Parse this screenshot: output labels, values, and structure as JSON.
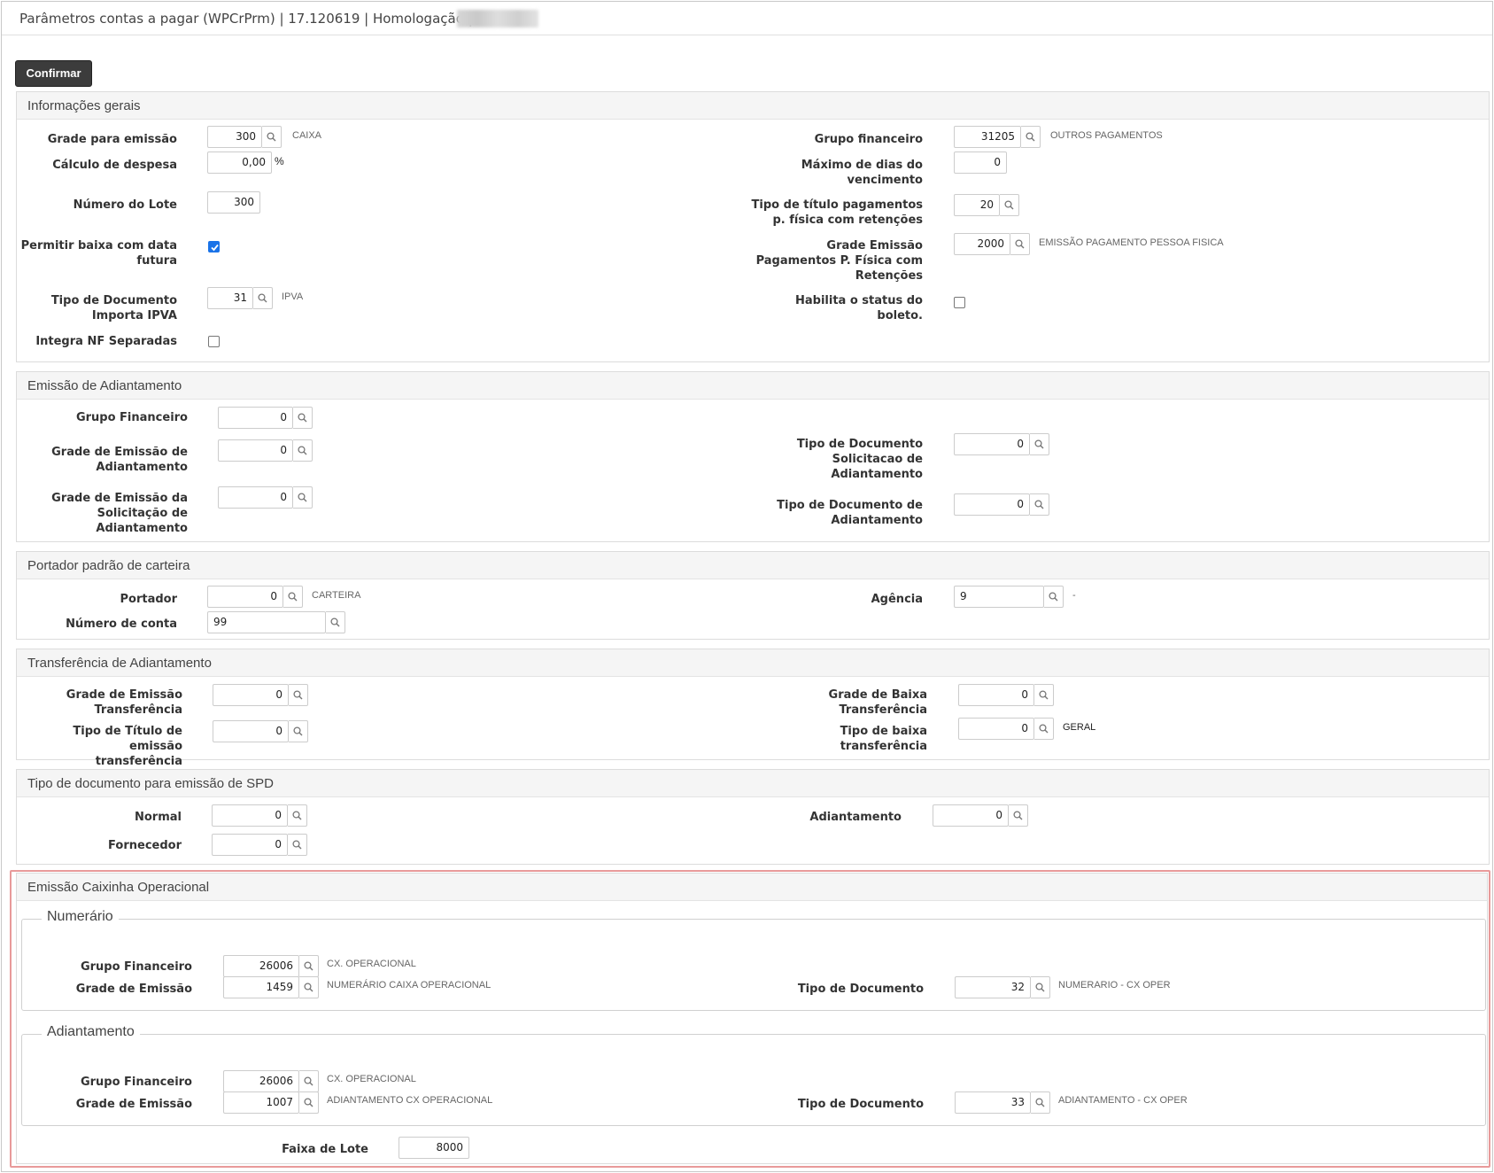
{
  "window": {
    "title": "Parâmetros contas a pagar (WPCrPrm) | 17.120619 | Homologação | S"
  },
  "toolbar": {
    "confirm_label": "Confirmar"
  },
  "sections": {
    "info_gerais": {
      "title": "Informações gerais",
      "grade_emissao": {
        "label": "Grade para emissão",
        "value": "300",
        "desc": "CAIXA"
      },
      "calculo_despesa": {
        "label": "Cálculo de despesa",
        "value": "0,00",
        "unit": "%"
      },
      "numero_lote": {
        "label": "Número do Lote",
        "value": "300"
      },
      "permitir_baixa": {
        "label_1": "Permitir baixa com data",
        "label_2": "futura",
        "checked": true
      },
      "tipo_doc_ipva": {
        "label_1": "Tipo de Documento",
        "label_2": "Importa IPVA",
        "value": "31",
        "desc": "IPVA"
      },
      "integra_nf": {
        "label": "Integra NF Separadas",
        "checked": false
      },
      "grupo_financeiro": {
        "label": "Grupo financeiro",
        "value": "31205",
        "desc": "OUTROS PAGAMENTOS"
      },
      "maximo_dias": {
        "label_1": "Máximo de dias do",
        "label_2": "vencimento",
        "value": "0"
      },
      "tipo_titulo_pf": {
        "label_1": "Tipo de título pagamentos",
        "label_2": "p. física com retenções",
        "value": "20"
      },
      "grade_emissao_pf": {
        "label_1": "Grade Emissão",
        "label_2": "Pagamentos P. Física com",
        "label_3": "Retenções",
        "value": "2000",
        "desc": "EMISSÃO PAGAMENTO PESSOA FISICA"
      },
      "habilita_status": {
        "label_1": "Habilita o status do",
        "label_2": "boleto.",
        "checked": false
      }
    },
    "emissao_adiantamento": {
      "title": "Emissão de Adiantamento",
      "grupo_financeiro": {
        "label": "Grupo Financeiro",
        "value": "0"
      },
      "grade_emissao_adiant": {
        "label_1": "Grade de Emissão de",
        "label_2": "Adiantamento",
        "value": "0"
      },
      "grade_emissao_solic": {
        "label_1": "Grade de Emissão da",
        "label_2": "Solicitação de",
        "label_3": "Adiantamento",
        "value": "0"
      },
      "tipo_doc_solic": {
        "label_1": "Tipo de Documento",
        "label_2": "Solicitacao de",
        "label_3": "Adiantamento",
        "value": "0"
      },
      "tipo_doc_adiant": {
        "label_1": "Tipo de Documento de",
        "label_2": "Adiantamento",
        "value": "0"
      }
    },
    "portador": {
      "title": "Portador padrão de carteira",
      "portador": {
        "label": "Portador",
        "value": "0",
        "desc": "CARTEIRA"
      },
      "numero_conta": {
        "label": "Número de conta",
        "value": "99"
      },
      "agencia": {
        "label": "Agência",
        "value": "9",
        "desc": "-"
      }
    },
    "transferencia": {
      "title": "Transferência de Adiantamento",
      "grade_emissao_transf": {
        "label_1": "Grade de Emissão",
        "label_2": "Transferência",
        "value": "0"
      },
      "tipo_titulo_transf": {
        "label_1": "Tipo de Título de emissão",
        "label_2": "transferência",
        "value": "0"
      },
      "grade_baixa_transf": {
        "label_1": "Grade de Baixa",
        "label_2": "Transferência",
        "value": "0"
      },
      "tipo_baixa_transf": {
        "label_1": "Tipo de baixa",
        "label_2": "transferência",
        "value": "0",
        "desc": "GERAL"
      }
    },
    "spd": {
      "title": "Tipo de documento para emissão de SPD",
      "normal": {
        "label": "Normal",
        "value": "0"
      },
      "fornecedor": {
        "label": "Fornecedor",
        "value": "0"
      },
      "adiantamento": {
        "label": "Adiantamento",
        "value": "0"
      }
    },
    "caixinha": {
      "title": "Emissão Caixinha Operacional",
      "numerario": {
        "legend": "Numerário",
        "grupo_financeiro": {
          "label": "Grupo Financeiro",
          "value": "26006",
          "desc": "CX. OPERACIONAL"
        },
        "grade_emissao": {
          "label": "Grade de Emissão",
          "value": "1459",
          "desc": "NUMERÁRIO CAIXA OPERACIONAL"
        },
        "tipo_documento": {
          "label": "Tipo de Documento",
          "value": "32",
          "desc": "NUMERARIO - CX OPER"
        }
      },
      "adiantamento": {
        "legend": "Adiantamento",
        "grupo_financeiro": {
          "label": "Grupo Financeiro",
          "value": "26006",
          "desc": "CX. OPERACIONAL"
        },
        "grade_emissao": {
          "label": "Grade de Emissão",
          "value": "1007",
          "desc": "ADIANTAMENTO CX OPERACIONAL"
        },
        "tipo_documento": {
          "label": "Tipo de Documento",
          "value": "33",
          "desc": "ADIANTAMENTO - CX OPER"
        }
      },
      "faixa_lote": {
        "label": "Faixa de Lote",
        "value": "8000"
      }
    }
  }
}
